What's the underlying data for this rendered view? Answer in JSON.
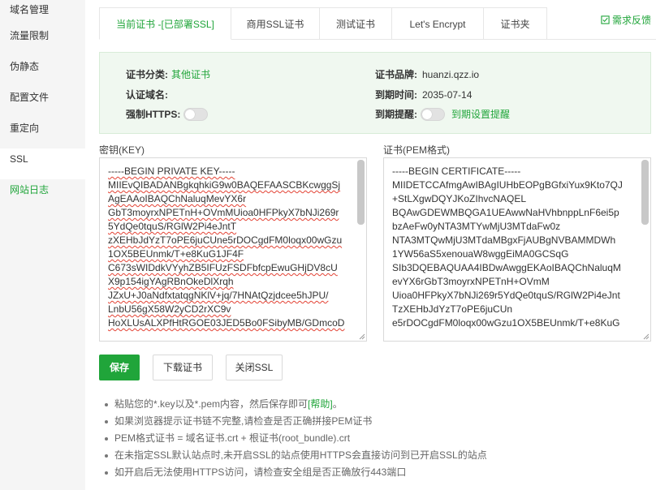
{
  "sidebar": {
    "items": [
      {
        "label": "域名管理"
      },
      {
        "label": "流量限制"
      },
      {
        "label": "伪静态"
      },
      {
        "label": "配置文件"
      },
      {
        "label": "重定向"
      },
      {
        "label": "SSL"
      },
      {
        "label": "网站日志"
      }
    ]
  },
  "tabs": [
    {
      "label": "当前证书 -[已部署SSL]"
    },
    {
      "label": "商用SSL证书"
    },
    {
      "label": "测试证书"
    },
    {
      "label": "Let's Encrypt"
    },
    {
      "label": "证书夹"
    }
  ],
  "feedback_label": "需求反馈",
  "info": {
    "cert_type_label": "证书分类:",
    "cert_type_value": "其他证书",
    "domain_label": "认证域名:",
    "domain_value": "",
    "https_label": "强制HTTPS:",
    "brand_label": "证书品牌:",
    "brand_value": "huanzi.qzz.io",
    "expire_label": "到期时间:",
    "expire_value": "2035-07-14",
    "remind_label": "到期提醒:",
    "remind_link": "到期设置提醒"
  },
  "key": {
    "label": "密钥(KEY)",
    "content": "-----BEGIN PRIVATE KEY-----\nMIIEvQIBADANBgkqhkiG9w0BAQEFAASCBKcwggSj\nAgEAAoIBAQChNaluqMevYX6r\nGbT3moyrxNPETnH+OVmMUioa0HFPkyX7bNJi269r\n5YdQe0tquS/RGlW2Pi4eJntT\nzXEHbJdYzT7oPE6juCUne5rDOCgdFM0loqx00wGzu\n1OX5BEUnmk/T+e8KuG1JF4F\nC673sWIDdkVYyhZB5IFUzFSDFbfcpEwuGHjDV8cU\nX9p154igYAgRBnOkeDlXrqh\nJZxU+J0aNdfxtatqgNKlV+jq/7HNAtQzjdcee5hJPU/\nLnbU56gX58W2yCD2rXC9v\nHoXLUsALXPfHtRGOE03JED5Bo0FSibyMB/GDmcoD"
  },
  "cert": {
    "label": "证书(PEM格式)",
    "content": "-----BEGIN CERTIFICATE-----\nMIIDETCCAfmgAwIBAgIUHbEOPgBGfxiYux9Kto7QJ\n+StLXgwDQYJKoZIhvcNAQEL\nBQAwGDEWMBQGA1UEAwwNaHVhbnppLnF6ei5p\nbzAeFw0yNTA3MTYwMjU3MTdaFw0z\nNTA3MTQwMjU3MTdaMBgxFjAUBgNVBAMMDWh\n1YW56aS5xenouaW8wggEiMA0GCSqG\nSIb3DQEBAQUAA4IBDwAwggEKAoIBAQChNaluqM\nevYX6rGbT3moyrxNPETnH+OVmM\nUioa0HFPkyX7bNJi269r5YdQe0tquS/RGlW2Pi4eJnt\nTzXEHbJdYzT7oPE6juCUn\ne5rDOCgdFM0loqx00wGzu1OX5BEUnmk/T+e8KuG"
  },
  "buttons": {
    "save": "保存",
    "download": "下载证书",
    "close_ssl": "关闭SSL"
  },
  "tips": {
    "t1_pre": "粘贴您的*.key以及*.pem内容，然后保存即可",
    "t1_help": "[帮助]",
    "t1_post": "。",
    "t2": "如果浏览器提示证书链不完整,请检查是否正确拼接PEM证书",
    "t3": "PEM格式证书 = 域名证书.crt + 根证书(root_bundle).crt",
    "t4": "在未指定SSL默认站点时,未开启SSL的站点使用HTTPS会直接访问到已开启SSL的站点",
    "t5": "如开启后无法使用HTTPS访问，请检查安全组是否正确放行443端口"
  },
  "colors": {
    "accent": "#20a53a",
    "info_bg": "#f0f8f0"
  }
}
